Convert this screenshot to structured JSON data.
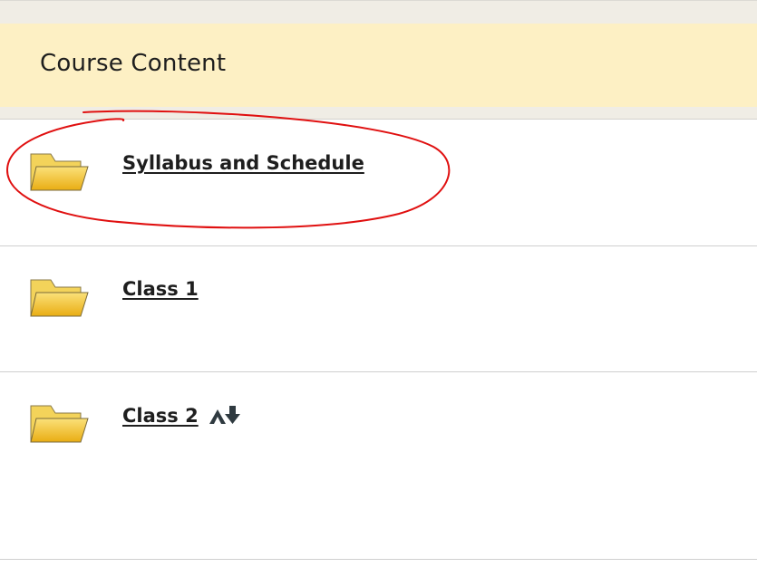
{
  "header": {
    "title": "Course Content"
  },
  "items": [
    {
      "label": "Syllabus and Schedule",
      "icon": "folder-icon"
    },
    {
      "label": "Class 1",
      "icon": "folder-icon"
    },
    {
      "label": "Class 2",
      "icon": "folder-icon",
      "badge_icon": "adaptive-release-icon"
    }
  ],
  "colors": {
    "header_background": "#fdf0c4",
    "strip_background": "#f0ede5",
    "annotation_stroke": "#e01010",
    "folder_yellow": "#f4c430"
  }
}
